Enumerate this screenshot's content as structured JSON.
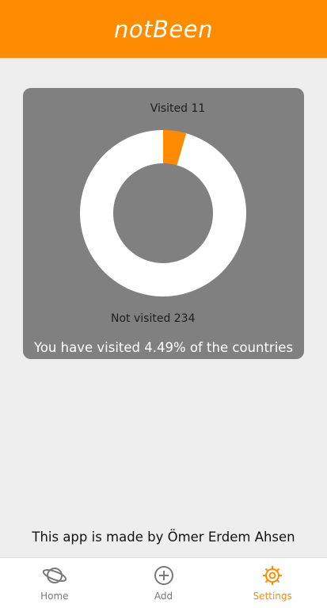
{
  "header": {
    "title": "notBeen"
  },
  "stats": {
    "visited_label": "Visited 11",
    "not_visited_label": "Not visited 234",
    "summary": "You have visited 4.49% of the countries"
  },
  "chart_data": {
    "type": "pie",
    "categories": [
      "Visited",
      "Not visited"
    ],
    "values": [
      11,
      234
    ],
    "colors": {
      "visited": "#ff8c00",
      "not_visited": "#ffffff",
      "background": "#808080"
    }
  },
  "footer": {
    "credit": "This app is made by Ömer Erdem Ahsen"
  },
  "tabs": [
    {
      "label": "Home",
      "icon": "planet-icon",
      "active": false
    },
    {
      "label": "Add",
      "icon": "add-circle-icon",
      "active": false
    },
    {
      "label": "Settings",
      "icon": "gear-icon",
      "active": true
    }
  ],
  "colors": {
    "accent": "#ff8c00",
    "inactive": "#7a7a7a"
  }
}
